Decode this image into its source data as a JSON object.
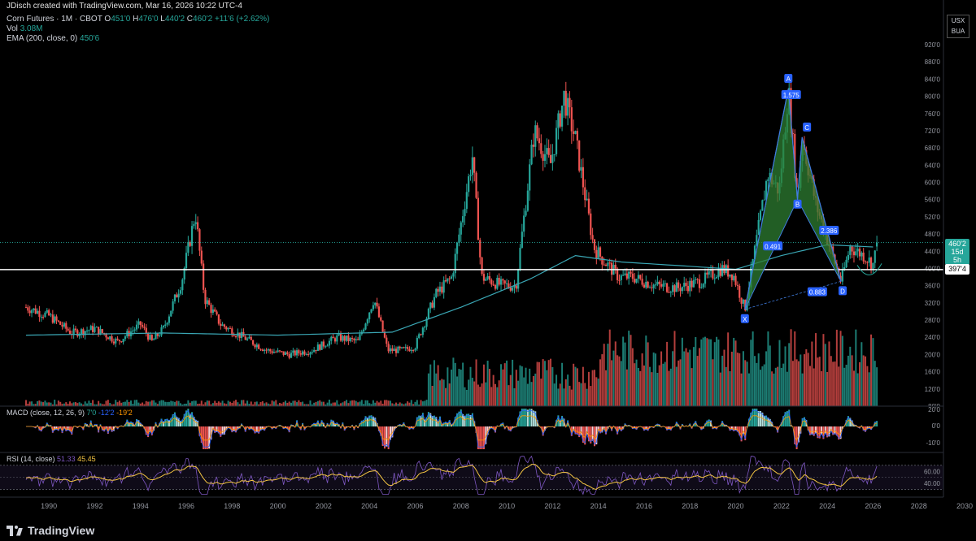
{
  "attribution": "JDisch created with TradingView.com, Mar 16, 2026 10:22 UTC-4",
  "legend": {
    "symbol": "Corn Futures · 1M · CBOT",
    "o_label": "O",
    "o_val": "451'0",
    "h_label": "H",
    "h_val": "476'0",
    "l_label": "L",
    "l_val": "440'2",
    "c_label": "C",
    "c_val": "460'2",
    "change": "+11'6 (+2.62%)",
    "vol_label": "Vol",
    "vol_val": "3.08M",
    "ema_label": "EMA (200, close, 0)",
    "ema_val": "450'6"
  },
  "currency": [
    "USX",
    "BUA"
  ],
  "price_axis_labels": [
    "920'0",
    "880'0",
    "840'0",
    "800'0",
    "760'0",
    "720'0",
    "680'0",
    "640'0",
    "600'0",
    "560'0",
    "520'0",
    "480'0",
    "440'0",
    "400'0",
    "360'0",
    "320'0",
    "280'0",
    "240'0",
    "200'0",
    "160'0",
    "120'0",
    "80'0"
  ],
  "current_price_tag": "460'2",
  "current_price_sub": "15d 5h",
  "horizontal_line_tag": "397'4",
  "time_axis_labels": [
    "1990",
    "1992",
    "1994",
    "1996",
    "1998",
    "2000",
    "2002",
    "2004",
    "2006",
    "2008",
    "2010",
    "2012",
    "2014",
    "2016",
    "2018",
    "2020",
    "2022",
    "2024",
    "2026",
    "2028",
    "2030"
  ],
  "pattern": {
    "points": [
      "X",
      "A",
      "B",
      "C",
      "D"
    ],
    "ratios": [
      "0.491",
      "1.575",
      "2.386",
      "0.883"
    ]
  },
  "macd": {
    "label": "MACD (close, 12, 26, 9)",
    "v1": "7'0",
    "v2": "-12'2",
    "v3": "-19'2",
    "axis": [
      "20'0",
      "0'0",
      "-10'0"
    ]
  },
  "rsi": {
    "label": "RSI (14, close)",
    "v1": "51.33",
    "v2": "45.45",
    "axis": [
      "60.00",
      "40.00"
    ]
  },
  "brand": "TradingView",
  "colors": {
    "up": "#26a69a",
    "down": "#ef5350",
    "ema": "#3aa7b5",
    "pattern_fill": "#2e7d32",
    "pattern_edge": "#3f7cdf",
    "rsi_line": "#7e57c2",
    "rsi_ma": "#f4c542",
    "macd_line": "#2962ff",
    "signal_line": "#ff9800",
    "bg": "#000000"
  },
  "chart_data": {
    "type": "candlestick",
    "symbol": "Corn Futures",
    "interval": "1M",
    "x_range": [
      "1989",
      "2030"
    ],
    "y_range": [
      80,
      920
    ],
    "key_points": [
      {
        "label": "X",
        "year": 2020.4,
        "price": 305
      },
      {
        "label": "A",
        "year": 2022.3,
        "price": 818
      },
      {
        "label": "B",
        "year": 2022.7,
        "price": 560
      },
      {
        "label": "C",
        "year": 2022.9,
        "price": 705
      },
      {
        "label": "D",
        "year": 2024.6,
        "price": 370
      }
    ],
    "anchors": [
      [
        1989.0,
        310
      ],
      [
        1990.0,
        290
      ],
      [
        1991.0,
        250
      ],
      [
        1992.0,
        260
      ],
      [
        1993.0,
        230
      ],
      [
        1994.0,
        270
      ],
      [
        1994.5,
        230
      ],
      [
        1995.0,
        260
      ],
      [
        1995.8,
        370
      ],
      [
        1996.4,
        530
      ],
      [
        1996.8,
        330
      ],
      [
        1997.5,
        270
      ],
      [
        1998.5,
        240
      ],
      [
        1999.5,
        210
      ],
      [
        2000.5,
        200
      ],
      [
        2001.5,
        210
      ],
      [
        2002.6,
        240
      ],
      [
        2003.5,
        230
      ],
      [
        2004.2,
        330
      ],
      [
        2004.8,
        210
      ],
      [
        2005.5,
        210
      ],
      [
        2006.0,
        220
      ],
      [
        2006.9,
        340
      ],
      [
        2007.6,
        380
      ],
      [
        2008.5,
        660
      ],
      [
        2008.9,
        380
      ],
      [
        2009.8,
        360
      ],
      [
        2010.4,
        360
      ],
      [
        2011.2,
        720
      ],
      [
        2011.9,
        640
      ],
      [
        2012.5,
        800
      ],
      [
        2013.0,
        700
      ],
      [
        2013.8,
        450
      ],
      [
        2014.2,
        420
      ],
      [
        2014.9,
        380
      ],
      [
        2015.5,
        380
      ],
      [
        2016.5,
        360
      ],
      [
        2017.5,
        355
      ],
      [
        2018.5,
        370
      ],
      [
        2019.4,
        400
      ],
      [
        2019.9,
        385
      ],
      [
        2020.4,
        305
      ],
      [
        2021.4,
        620
      ],
      [
        2021.9,
        580
      ],
      [
        2022.3,
        818
      ],
      [
        2022.7,
        560
      ],
      [
        2022.9,
        705
      ],
      [
        2023.5,
        550
      ],
      [
        2024.6,
        370
      ],
      [
        2025.0,
        450
      ],
      [
        2025.6,
        430
      ],
      [
        2026.0,
        410
      ],
      [
        2026.2,
        460
      ]
    ],
    "ema200_anchors": [
      [
        1989,
        245
      ],
      [
        1995,
        250
      ],
      [
        2000,
        245
      ],
      [
        2005,
        252
      ],
      [
        2008,
        310
      ],
      [
        2011,
        375
      ],
      [
        2013,
        430
      ],
      [
        2015,
        415
      ],
      [
        2018,
        405
      ],
      [
        2020,
        398
      ],
      [
        2022,
        430
      ],
      [
        2024,
        455
      ],
      [
        2026,
        450
      ]
    ],
    "horizontal_line": 397.4,
    "current_price": 460.2
  }
}
